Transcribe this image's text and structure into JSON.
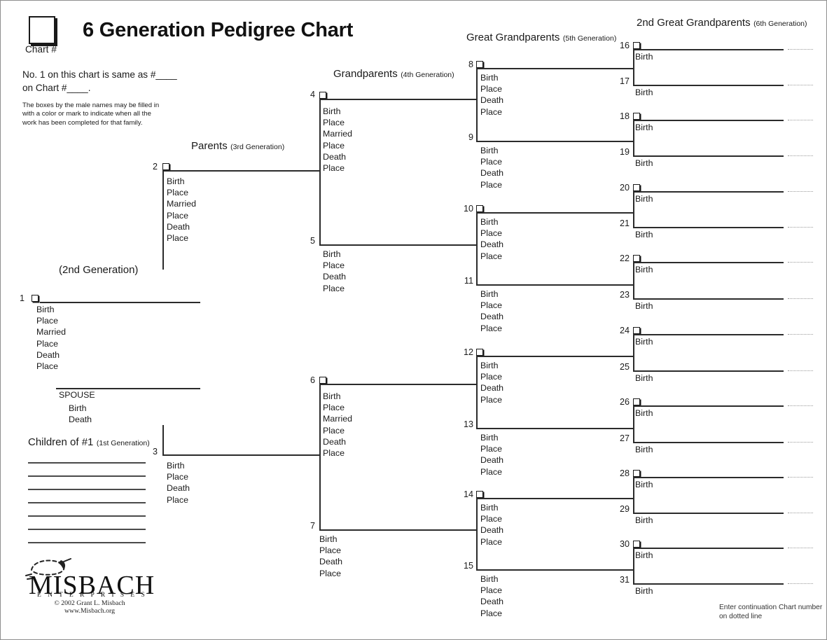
{
  "header": {
    "title": "6 Generation Pedigree Chart",
    "chart_number_label": "Chart #",
    "note_same_chart": "No. 1 on this chart is same as #____ on Chart #____.",
    "note_small": "The boxes by the male names may be filled in with a color or mark to indicate when all the work has been completed for that family."
  },
  "generation_headings": {
    "gen1": {
      "big": "Children of #1",
      "small": "(1st Generation)"
    },
    "gen2": {
      "big": "(2nd Generation)",
      "small": ""
    },
    "gen3": {
      "big": "Parents",
      "small": "(3rd Generation)"
    },
    "gen4": {
      "big": "Grandparents",
      "small": "(4th Generation)"
    },
    "gen5": {
      "big": "Great Grandparents",
      "small": "(5th Generation)"
    },
    "gen6": {
      "big": "2nd Great Grandparents",
      "small": "(6th Generation)"
    }
  },
  "field_sets": {
    "full": [
      "Birth",
      "Place",
      "Married",
      "Place",
      "Death",
      "Place"
    ],
    "short": [
      "Birth",
      "Place",
      "Death",
      "Place"
    ],
    "spouse": [
      "Birth",
      "Death"
    ],
    "birth_only": [
      "Birth"
    ]
  },
  "spouse_label": "SPOUSE",
  "persons": [
    {
      "num": "1",
      "gen": 2,
      "box": true,
      "fields": "full"
    },
    {
      "num": "2",
      "gen": 3,
      "box": true,
      "fields": "full"
    },
    {
      "num": "3",
      "gen": 3,
      "box": false,
      "fields": "short"
    },
    {
      "num": "4",
      "gen": 4,
      "box": true,
      "fields": "full"
    },
    {
      "num": "5",
      "gen": 4,
      "box": false,
      "fields": "short"
    },
    {
      "num": "6",
      "gen": 4,
      "box": true,
      "fields": "full"
    },
    {
      "num": "7",
      "gen": 4,
      "box": false,
      "fields": "short"
    },
    {
      "num": "8",
      "gen": 5,
      "box": true,
      "fields": "short"
    },
    {
      "num": "9",
      "gen": 5,
      "box": false,
      "fields": "short"
    },
    {
      "num": "10",
      "gen": 5,
      "box": true,
      "fields": "short"
    },
    {
      "num": "11",
      "gen": 5,
      "box": false,
      "fields": "short"
    },
    {
      "num": "12",
      "gen": 5,
      "box": true,
      "fields": "short"
    },
    {
      "num": "13",
      "gen": 5,
      "box": false,
      "fields": "short"
    },
    {
      "num": "14",
      "gen": 5,
      "box": true,
      "fields": "short"
    },
    {
      "num": "15",
      "gen": 5,
      "box": false,
      "fields": "short"
    },
    {
      "num": "16",
      "gen": 6,
      "box": true,
      "fields": "birth_only"
    },
    {
      "num": "17",
      "gen": 6,
      "box": false,
      "fields": "birth_only"
    },
    {
      "num": "18",
      "gen": 6,
      "box": true,
      "fields": "birth_only"
    },
    {
      "num": "19",
      "gen": 6,
      "box": false,
      "fields": "birth_only"
    },
    {
      "num": "20",
      "gen": 6,
      "box": true,
      "fields": "birth_only"
    },
    {
      "num": "21",
      "gen": 6,
      "box": false,
      "fields": "birth_only"
    },
    {
      "num": "22",
      "gen": 6,
      "box": true,
      "fields": "birth_only"
    },
    {
      "num": "23",
      "gen": 6,
      "box": false,
      "fields": "birth_only"
    },
    {
      "num": "24",
      "gen": 6,
      "box": true,
      "fields": "birth_only"
    },
    {
      "num": "25",
      "gen": 6,
      "box": false,
      "fields": "birth_only"
    },
    {
      "num": "26",
      "gen": 6,
      "box": true,
      "fields": "birth_only"
    },
    {
      "num": "27",
      "gen": 6,
      "box": false,
      "fields": "birth_only"
    },
    {
      "num": "28",
      "gen": 6,
      "box": true,
      "fields": "birth_only"
    },
    {
      "num": "29",
      "gen": 6,
      "box": false,
      "fields": "birth_only"
    },
    {
      "num": "30",
      "gen": 6,
      "box": true,
      "fields": "birth_only"
    },
    {
      "num": "31",
      "gen": 6,
      "box": false,
      "fields": "birth_only"
    }
  ],
  "children_line_count": 7,
  "continuation_note": "Enter continuation Chart number on dotted line",
  "footer": {
    "logo_word": "MISBACH",
    "logo_sub": "E N T E R P R I S E S",
    "copyright": "© 2002 Grant L. Misbach",
    "website": "www.Misbach.org"
  },
  "colors": {
    "ink": "#1a1a1a",
    "rule": "#2b2b2b",
    "child_rule": "#4a4a4a",
    "dotted": "#9a9a9a",
    "page_border": "#8e8e8e",
    "background": "#ffffff"
  }
}
